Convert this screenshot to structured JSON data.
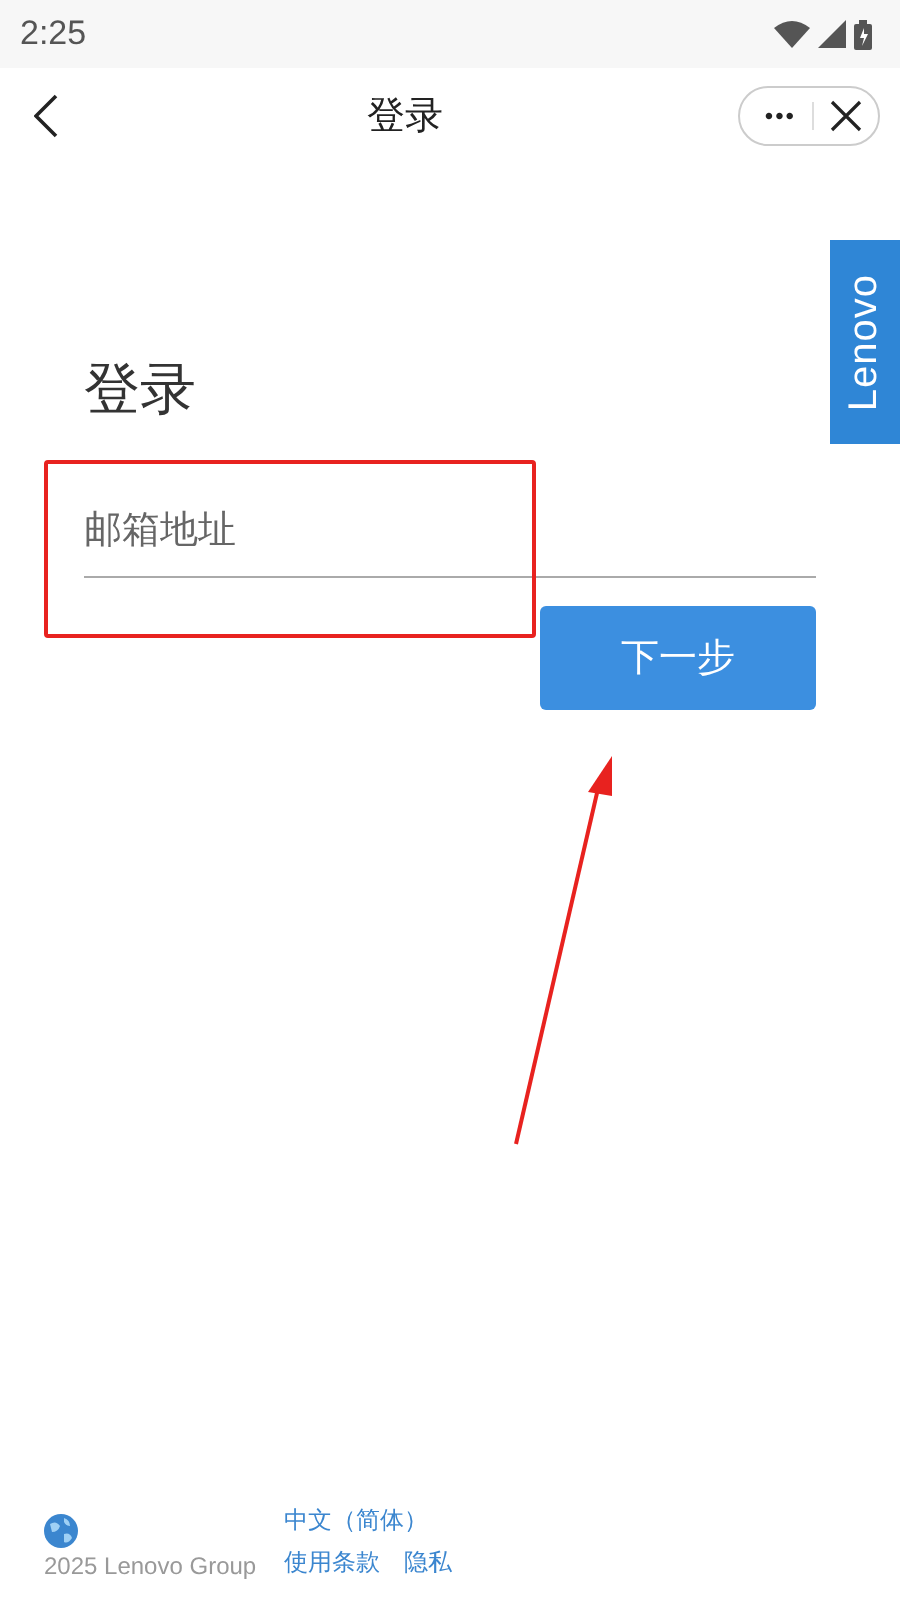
{
  "status_bar": {
    "time": "2:25"
  },
  "nav_bar": {
    "title": "登录",
    "more": "•••"
  },
  "side_logo": {
    "text": "Lenovo"
  },
  "login": {
    "heading": "登录",
    "email_field": {
      "placeholder": "邮箱地址"
    },
    "next_button": "下一步"
  },
  "annotations": {
    "highlight_box": true,
    "arrow": true
  },
  "footer": {
    "copyright": "2025 Lenovo Group",
    "language": "中文（简体）",
    "links": [
      "使用条款",
      "隐私"
    ]
  }
}
